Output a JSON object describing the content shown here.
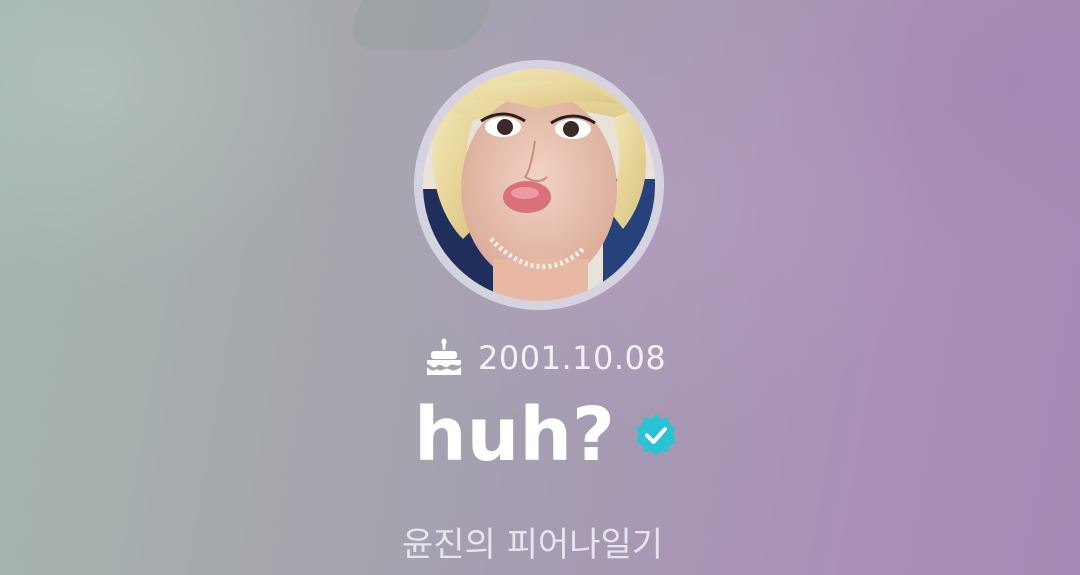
{
  "profile": {
    "birthday": "2001.10.08",
    "name": "huh?",
    "verified": true,
    "subtitle": "윤진의 피어나일기"
  },
  "icons": {
    "birthday": "cake-icon",
    "verified": "verified-badge-icon"
  },
  "colors": {
    "background_left": "#a5b6b0",
    "background_right": "#a889b5",
    "avatar_ring": "#d6d3e0",
    "verified_badge": "#29c3d4",
    "text_primary": "#ffffff"
  }
}
